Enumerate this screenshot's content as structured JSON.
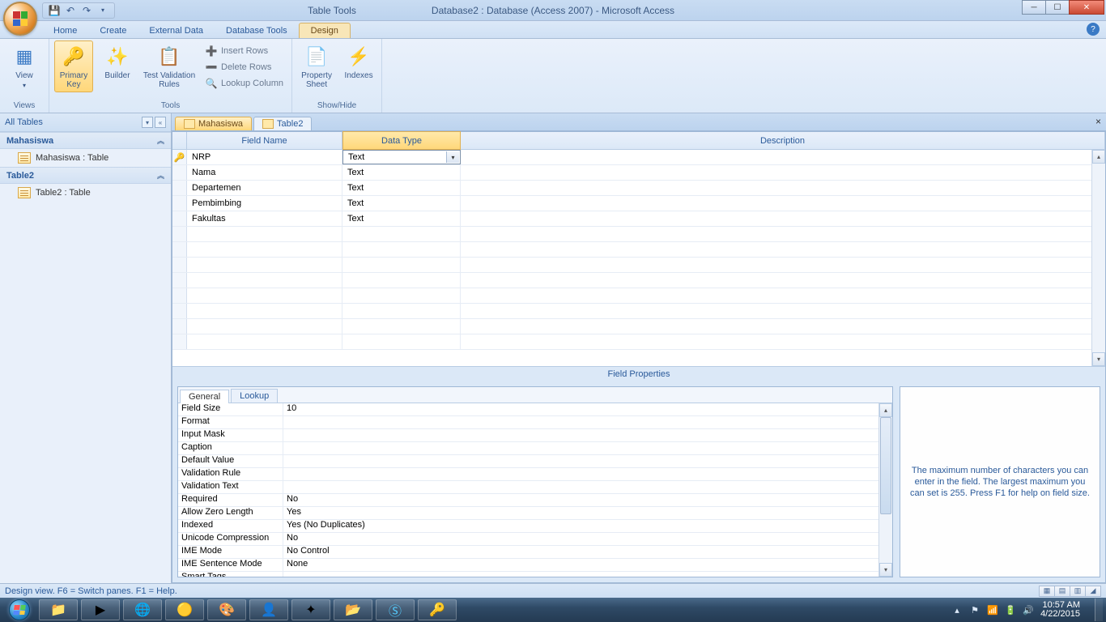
{
  "titlebar": {
    "table_tools": "Table Tools",
    "title": "Database2 : Database (Access 2007)  -  Microsoft Access"
  },
  "ribbon_tabs": {
    "home": "Home",
    "create": "Create",
    "external": "External Data",
    "dbtools": "Database Tools",
    "design": "Design"
  },
  "ribbon": {
    "views_group": "Views",
    "view": "View",
    "tools_group": "Tools",
    "primary_key": "Primary\nKey",
    "builder": "Builder",
    "test_validation": "Test Validation\nRules",
    "insert_rows": "Insert Rows",
    "delete_rows": "Delete Rows",
    "lookup_column": "Lookup Column",
    "showhide_group": "Show/Hide",
    "property_sheet": "Property\nSheet",
    "indexes": "Indexes"
  },
  "nav": {
    "header": "All Tables",
    "groups": [
      {
        "name": "Mahasiswa",
        "items": [
          "Mahasiswa : Table"
        ]
      },
      {
        "name": "Table2",
        "items": [
          "Table2 : Table"
        ]
      }
    ]
  },
  "docs": {
    "tabs": [
      "Mahasiswa",
      "Table2"
    ],
    "active": 0
  },
  "design_grid": {
    "headers": {
      "field_name": "Field Name",
      "data_type": "Data Type",
      "description": "Description"
    },
    "rows": [
      {
        "pk": true,
        "name": "NRP",
        "type": "Text",
        "desc": ""
      },
      {
        "pk": false,
        "name": "Nama",
        "type": "Text",
        "desc": ""
      },
      {
        "pk": false,
        "name": "Departemen",
        "type": "Text",
        "desc": ""
      },
      {
        "pk": false,
        "name": "Pembimbing",
        "type": "Text",
        "desc": ""
      },
      {
        "pk": false,
        "name": "Fakultas",
        "type": "Text",
        "desc": ""
      }
    ],
    "empty_rows": 8
  },
  "field_properties": {
    "title": "Field Properties",
    "tabs": {
      "general": "General",
      "lookup": "Lookup"
    },
    "rows": [
      {
        "k": "Field Size",
        "v": "10"
      },
      {
        "k": "Format",
        "v": ""
      },
      {
        "k": "Input Mask",
        "v": ""
      },
      {
        "k": "Caption",
        "v": ""
      },
      {
        "k": "Default Value",
        "v": ""
      },
      {
        "k": "Validation Rule",
        "v": ""
      },
      {
        "k": "Validation Text",
        "v": ""
      },
      {
        "k": "Required",
        "v": "No"
      },
      {
        "k": "Allow Zero Length",
        "v": "Yes"
      },
      {
        "k": "Indexed",
        "v": "Yes (No Duplicates)"
      },
      {
        "k": "Unicode Compression",
        "v": "No"
      },
      {
        "k": "IME Mode",
        "v": "No Control"
      },
      {
        "k": "IME Sentence Mode",
        "v": "None"
      },
      {
        "k": "Smart Tags",
        "v": ""
      }
    ],
    "help": "The maximum number of characters you can enter in the field.  The largest maximum you can set is 255.  Press F1 for help on field size."
  },
  "statusbar": {
    "text": "Design view.   F6 = Switch panes.   F1 = Help."
  },
  "taskbar": {
    "time": "10:57 AM",
    "date": "4/22/2015"
  }
}
